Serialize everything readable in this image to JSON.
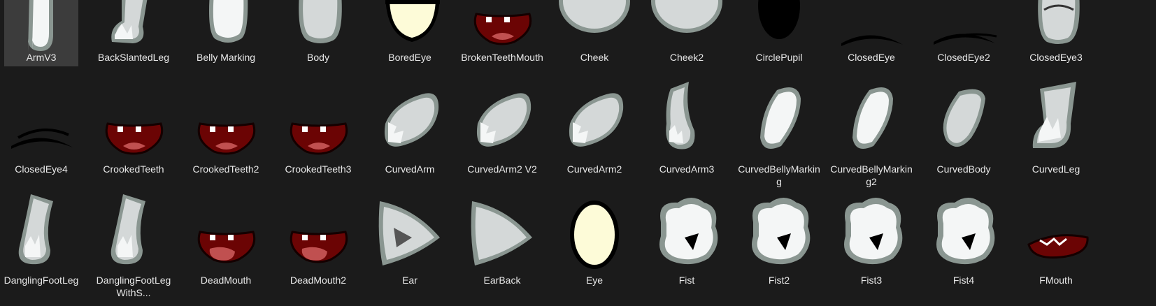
{
  "items": [
    {
      "label": "ArmV3",
      "icon": "arm-icon",
      "selected": true
    },
    {
      "label": "BackSlantedLeg",
      "icon": "leg-icon"
    },
    {
      "label": "Belly Marking",
      "icon": "belly-marking-icon"
    },
    {
      "label": "Body",
      "icon": "body-icon"
    },
    {
      "label": "BoredEye",
      "icon": "bored-eye-icon"
    },
    {
      "label": "BrokenTeethMouth",
      "icon": "mouth-icon"
    },
    {
      "label": "Cheek",
      "icon": "cheek-icon"
    },
    {
      "label": "Cheek2",
      "icon": "cheek-icon"
    },
    {
      "label": "CirclePupil",
      "icon": "pupil-icon"
    },
    {
      "label": "ClosedEye",
      "icon": "closed-eye-icon"
    },
    {
      "label": "ClosedEye2",
      "icon": "closed-eye-icon"
    },
    {
      "label": "ClosedEye3",
      "icon": "closed-eye-icon"
    },
    {
      "label": "ClosedEye4",
      "icon": "closed-eye-icon"
    },
    {
      "label": "CrookedTeeth",
      "icon": "mouth-icon"
    },
    {
      "label": "CrookedTeeth2",
      "icon": "mouth-icon"
    },
    {
      "label": "CrookedTeeth3",
      "icon": "mouth-icon"
    },
    {
      "label": "CurvedArm",
      "icon": "arm-icon"
    },
    {
      "label": "CurvedArm2 V2",
      "icon": "arm-icon"
    },
    {
      "label": "CurvedArm2",
      "icon": "arm-icon"
    },
    {
      "label": "CurvedArm3",
      "icon": "arm-icon"
    },
    {
      "label": "CurvedBellyMarking",
      "icon": "belly-marking-icon"
    },
    {
      "label": "CurvedBellyMarking2",
      "icon": "belly-marking-icon"
    },
    {
      "label": "CurvedBody",
      "icon": "body-icon"
    },
    {
      "label": "CurvedLeg",
      "icon": "leg-icon"
    },
    {
      "label": "DanglingFootLeg",
      "icon": "leg-icon"
    },
    {
      "label": "DanglingFootLegWithS...",
      "icon": "leg-icon"
    },
    {
      "label": "DeadMouth",
      "icon": "mouth-icon"
    },
    {
      "label": "DeadMouth2",
      "icon": "mouth-icon"
    },
    {
      "label": "Ear",
      "icon": "ear-icon"
    },
    {
      "label": "EarBack",
      "icon": "ear-icon"
    },
    {
      "label": "Eye",
      "icon": "eye-icon"
    },
    {
      "label": "Fist",
      "icon": "fist-icon"
    },
    {
      "label": "Fist2",
      "icon": "fist-icon"
    },
    {
      "label": "Fist3",
      "icon": "fist-icon"
    },
    {
      "label": "Fist4",
      "icon": "fist-icon"
    },
    {
      "label": "FMouth",
      "icon": "mouth-icon"
    }
  ],
  "colors": {
    "background": "#1b1b1b",
    "selected": "#3c3c3c",
    "outline": "#8a9691",
    "fill_light": "#f4f6f6",
    "fill_grey": "#d4d8d8",
    "mouth": "#6b0404",
    "tongue": "#c05050",
    "eye": "#fdfbd8",
    "black": "#000000"
  }
}
